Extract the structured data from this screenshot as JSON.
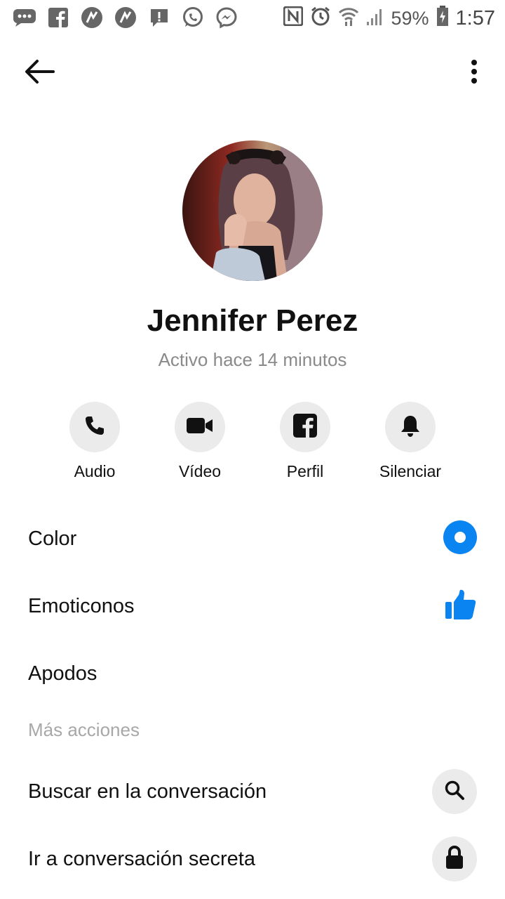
{
  "status_bar": {
    "battery": "59%",
    "time": "1:57",
    "left_icons": [
      "sms-icon",
      "facebook-icon",
      "ticktick-icon",
      "ticktick-icon",
      "alert-icon",
      "whatsapp-icon",
      "messenger-icon"
    ],
    "right_icons": [
      "nfc-icon",
      "alarm-icon",
      "wifi-icon",
      "signal-icon",
      "battery-icon"
    ]
  },
  "header": {
    "back_icon": "arrow-left-icon",
    "menu_icon": "more-vertical-icon"
  },
  "profile": {
    "name": "Jennifer Perez",
    "status": "Activo hace 14 minutos"
  },
  "actions": [
    {
      "label": "Audio",
      "icon": "phone-icon"
    },
    {
      "label": "Vídeo",
      "icon": "video-icon"
    },
    {
      "label": "Perfil",
      "icon": "facebook-icon"
    },
    {
      "label": "Silenciar",
      "icon": "bell-icon"
    }
  ],
  "settings": {
    "color_label": "Color",
    "emoji_label": "Emoticonos",
    "nicknames_label": "Apodos"
  },
  "more_actions": {
    "section_title": "Más acciones",
    "search_label": "Buscar en la conversación",
    "secret_label": "Ir a conversación secreta"
  },
  "colors": {
    "accent": "#0a84f0",
    "circle_bg": "#ebebeb",
    "muted_text": "#8a8a8a",
    "section_text": "#a8a8a8"
  }
}
